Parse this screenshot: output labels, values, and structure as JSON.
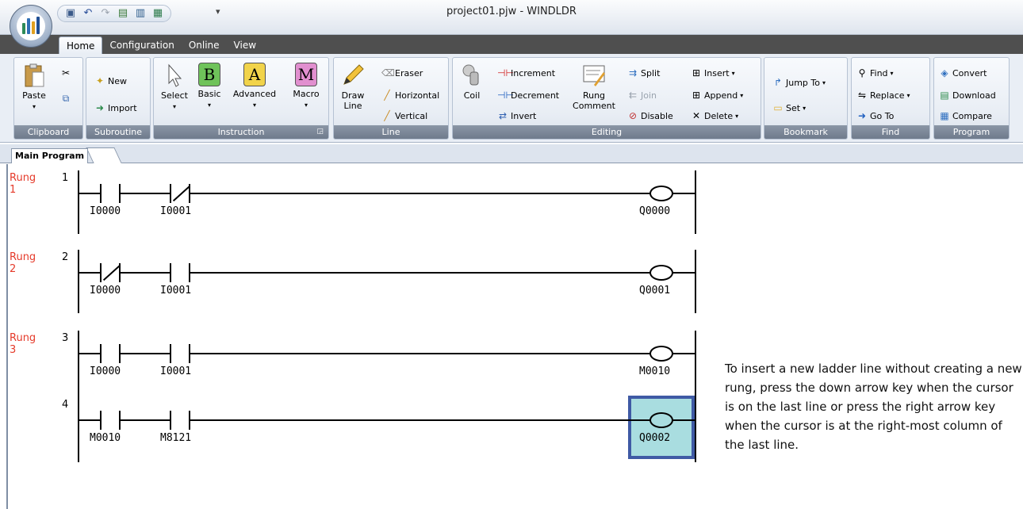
{
  "window": {
    "title": "project01.pjw - WINDLDR"
  },
  "tabs": [
    {
      "label": "Home",
      "active": true
    },
    {
      "label": "Configuration",
      "active": false
    },
    {
      "label": "Online",
      "active": false
    },
    {
      "label": "View",
      "active": false
    }
  ],
  "ribbon": {
    "clipboard": {
      "label": "Clipboard",
      "paste": "Paste"
    },
    "subroutine": {
      "label": "Subroutine",
      "new": "New",
      "import": "Import"
    },
    "instruction": {
      "label": "Instruction",
      "select": "Select",
      "basic": "Basic",
      "advanced": "Advanced",
      "macro": "Macro",
      "basic_letter": "B",
      "advanced_letter": "A",
      "macro_letter": "M"
    },
    "line": {
      "label": "Line",
      "draw_line": "Draw\nLine",
      "eraser": "Eraser",
      "horizontal": "Horizontal",
      "vertical": "Vertical"
    },
    "editing": {
      "label": "Editing",
      "coil": "Coil",
      "increment": "Increment",
      "decrement": "Decrement",
      "invert": "Invert",
      "rung_comment": "Rung\nComment",
      "split": "Split",
      "join": "Join",
      "disable": "Disable",
      "insert": "Insert",
      "append": "Append",
      "delete": "Delete"
    },
    "bookmark": {
      "label": "Bookmark",
      "jump_to": "Jump To",
      "set": "Set"
    },
    "find": {
      "label": "Find",
      "find": "Find",
      "replace": "Replace",
      "goto": "Go To"
    },
    "program": {
      "label": "Program",
      "convert": "Convert",
      "download": "Download",
      "compare": "Compare"
    }
  },
  "document_tab": "Main Program",
  "rungs": [
    {
      "label": "Rung\n1",
      "lines": [
        {
          "num": "1",
          "contacts": [
            "I0000",
            "I0001"
          ],
          "coil": "Q0000"
        }
      ]
    },
    {
      "label": "Rung\n2",
      "lines": [
        {
          "num": "2",
          "contacts": [
            "I0000",
            "I0001"
          ],
          "coil": "Q0001"
        }
      ]
    },
    {
      "label": "Rung\n3",
      "lines": [
        {
          "num": "3",
          "contacts": [
            "I0000",
            "I0001"
          ],
          "coil": "M0010"
        },
        {
          "num": "4",
          "contacts": [
            "M0010",
            "M8121"
          ],
          "coil": "Q0002"
        }
      ]
    }
  ],
  "note": "To insert a new ladder line without creating a new rung, press the down arrow key when the cursor is on the last line or press the right arrow key when the cursor is at the right-most column of the last line."
}
